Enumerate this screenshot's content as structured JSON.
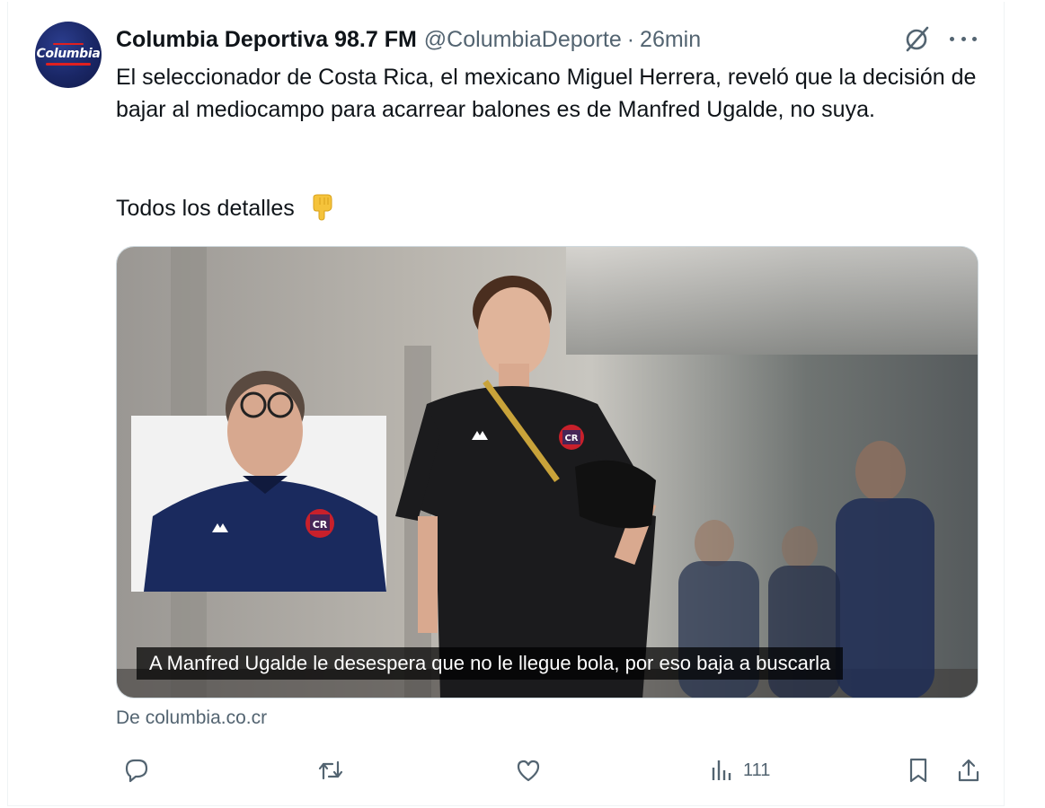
{
  "tweet": {
    "display_name": "Columbia Deportiva 98.7 FM",
    "handle": "@ColumbiaDeporte",
    "separator": "·",
    "time": "26min",
    "avatar_text": "Columbia",
    "body": "El seleccionador de Costa Rica, el mexicano Miguel Herrera, reveló que la decisión de bajar al mediocampo para acarrear balones es de Manfred Ugalde, no suya.",
    "body_line2": "Todos los detalles",
    "emoji": "backhand-index-pointing-down",
    "media": {
      "caption": "A Manfred Ugalde le desespera que no le llegue bola, por eso baja a buscarla",
      "badge_text": "CR"
    },
    "source_prefix": "De",
    "source_domain": "columbia.co.cr",
    "views": "111"
  },
  "icons": {
    "grok": "grok-icon",
    "more": "more-icon",
    "reply": "reply-icon",
    "retweet": "retweet-icon",
    "like": "like-icon",
    "views": "views-icon",
    "bookmark": "bookmark-icon",
    "share": "share-icon"
  },
  "colors": {
    "text": "#0f1419",
    "secondary": "#536471",
    "brand_navy": "#1a2766",
    "emoji_yellow": "#f5c33b"
  }
}
